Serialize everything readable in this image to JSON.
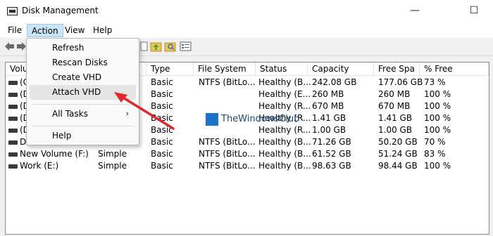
{
  "window": {
    "title": "Disk Management"
  },
  "window_buttons": {
    "minimize": "—",
    "maximize": "☐"
  },
  "menubar": {
    "items": [
      "File",
      "Action",
      "View",
      "Help"
    ]
  },
  "table": {
    "columns": [
      "Volu",
      "Type",
      "File System",
      "Status",
      "Capacity",
      "Free Spa",
      "% Free"
    ],
    "rows": [
      {
        "volume": "(C",
        "type": "Basic",
        "fs": "NTFS (BitLo...",
        "status": "Healthy (B...",
        "capacity": "242.08 GB",
        "free": "177.06 GB",
        "pct": "73 %"
      },
      {
        "volume": "(D",
        "type": "Basic",
        "fs": "",
        "status": "Healthy (E...",
        "capacity": "260 MB",
        "free": "260 MB",
        "pct": "100 %"
      },
      {
        "volume": "(D",
        "type": "Basic",
        "fs": "",
        "status": "Healthy (R...",
        "capacity": "670 MB",
        "free": "670 MB",
        "pct": "100 %"
      },
      {
        "volume": "(D",
        "type": "Basic",
        "fs": "",
        "status": "Healthy (R...",
        "capacity": "1.41 GB",
        "free": "1.41 GB",
        "pct": "100 %"
      },
      {
        "volume": "(D",
        "type": "Basic",
        "fs": "",
        "status": "Healthy (R...",
        "capacity": "1.00 GB",
        "free": "1.00 GB",
        "pct": "100 %"
      },
      {
        "volume": "Da",
        "type": "Basic",
        "fs": "NTFS (BitLo...",
        "status": "Healthy (B...",
        "capacity": "71.26 GB",
        "free": "50.20 GB",
        "pct": "70 %"
      },
      {
        "volume": "New Volume (F:)",
        "layout": "Simple",
        "type": "Basic",
        "fs": "NTFS (BitLo...",
        "status": "Healthy (B...",
        "capacity": "61.52 GB",
        "free": "51.24 GB",
        "pct": "83 %"
      },
      {
        "volume": "Work (E:)",
        "layout": "Simple",
        "type": "Basic",
        "fs": "NTFS (BitLo...",
        "status": "Healthy (B...",
        "capacity": "98.63 GB",
        "free": "98.44 GB",
        "pct": "100 %"
      }
    ]
  },
  "action_menu": {
    "items": [
      "Refresh",
      "Rescan Disks",
      "Create VHD",
      "Attach VHD",
      "All Tasks",
      "Help"
    ],
    "highlighted": "Attach VHD",
    "submenu_arrow": "›"
  },
  "watermark": {
    "text": "TheWindowsClub"
  },
  "colors": {
    "annotation_arrow": "#e0282e",
    "menu_active": "#cce4f7",
    "watermark_logo": "#1a73c9"
  },
  "icons": [
    "app-icon",
    "back-arrow-icon",
    "forward-arrow-icon",
    "folder-up-icon",
    "folder-search-icon",
    "properties-icon",
    "disk-icon"
  ]
}
